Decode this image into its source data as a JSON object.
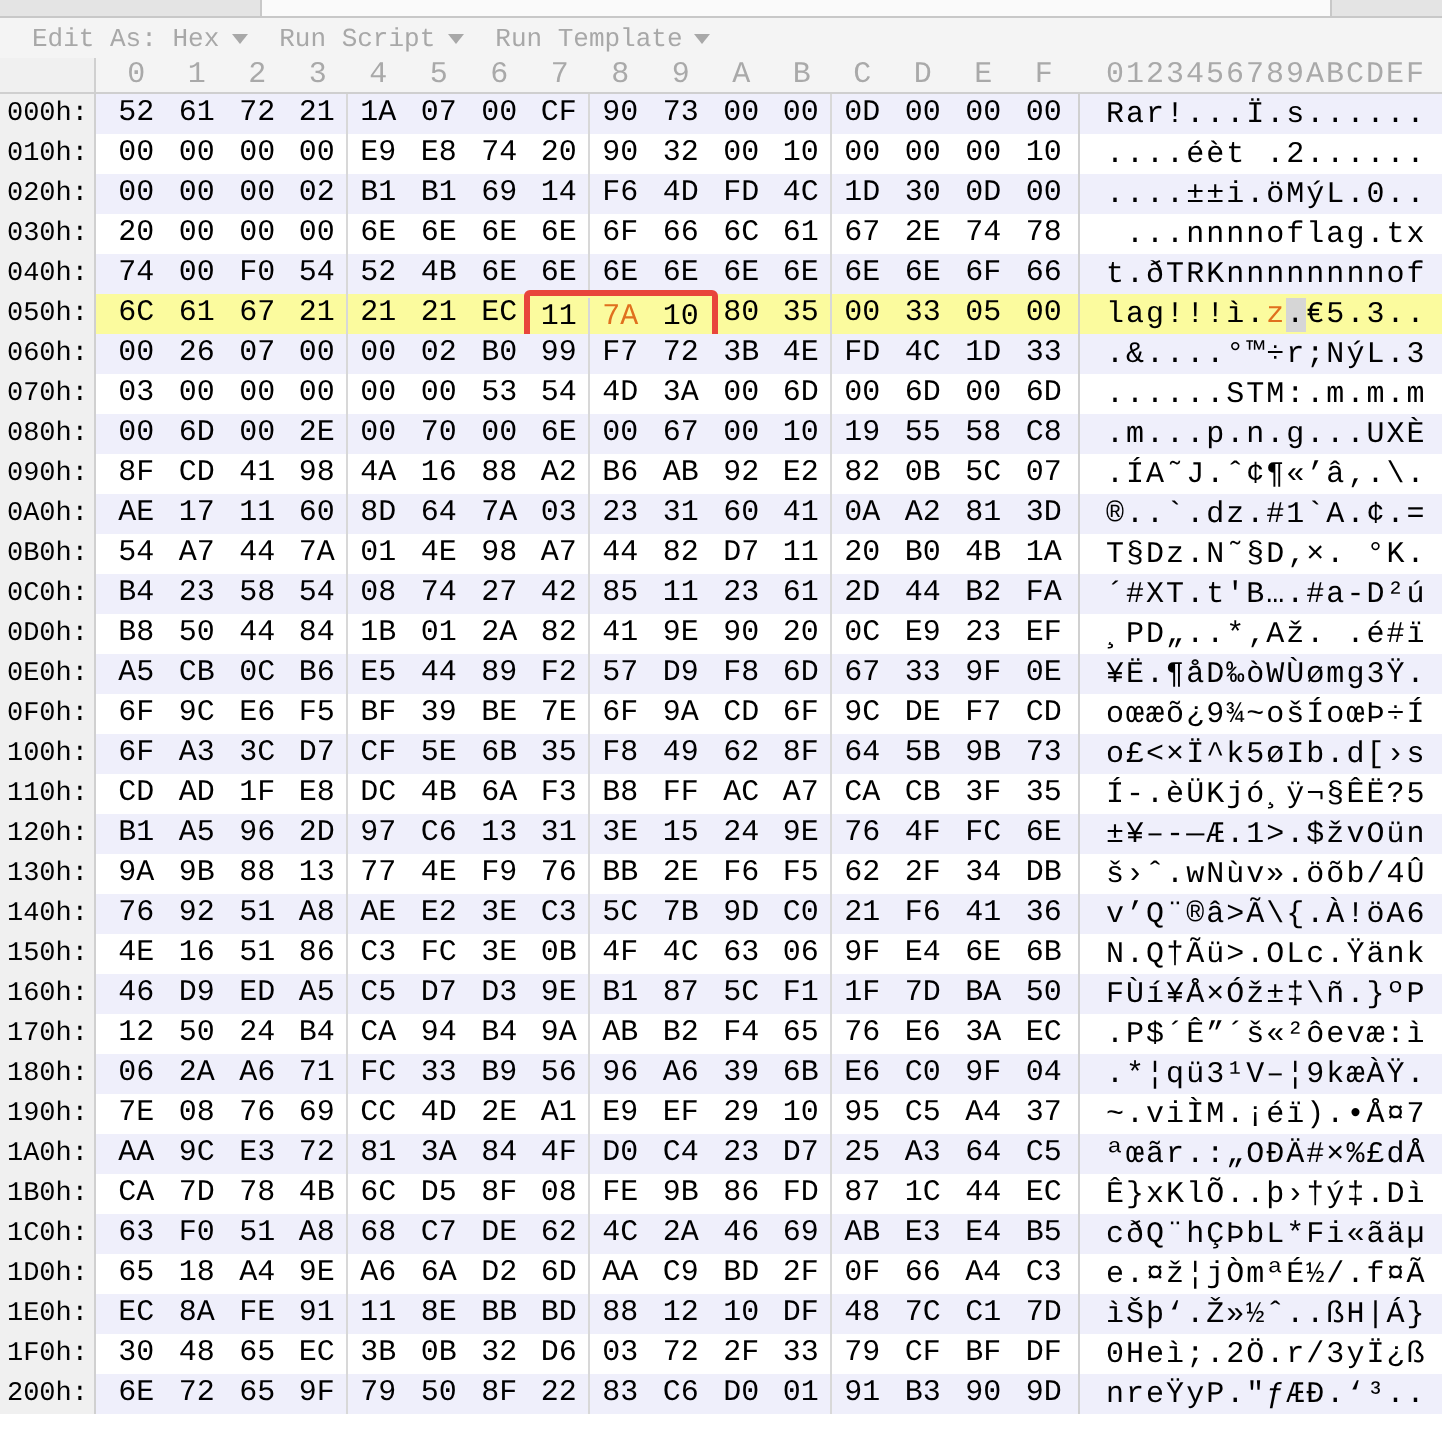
{
  "toolbar": [
    {
      "label": "Edit As: Hex",
      "disabled": true
    },
    {
      "label": "Run Script",
      "disabled": true
    },
    {
      "label": "Run Template",
      "disabled": true
    }
  ],
  "columns": [
    "0",
    "1",
    "2",
    "3",
    "4",
    "5",
    "6",
    "7",
    "8",
    "9",
    "A",
    "B",
    "C",
    "D",
    "E",
    "F"
  ],
  "ascii_header": "0123456789ABCDEF",
  "rows": [
    {
      "offset": "000h:",
      "current": false,
      "bytes": [
        "52",
        "61",
        "72",
        "21",
        "1A",
        "07",
        "00",
        "CF",
        "90",
        "73",
        "00",
        "00",
        "0D",
        "00",
        "00",
        "00"
      ],
      "ascii": "Rar!...Ï.s......"
    },
    {
      "offset": "010h:",
      "current": false,
      "bytes": [
        "00",
        "00",
        "00",
        "00",
        "E9",
        "E8",
        "74",
        "20",
        "90",
        "32",
        "00",
        "10",
        "00",
        "00",
        "00",
        "10"
      ],
      "ascii": "....éèt .2......"
    },
    {
      "offset": "020h:",
      "current": false,
      "bytes": [
        "00",
        "00",
        "00",
        "02",
        "B1",
        "B1",
        "69",
        "14",
        "F6",
        "4D",
        "FD",
        "4C",
        "1D",
        "30",
        "0D",
        "00"
      ],
      "ascii": "....±±i.öMýL.0.."
    },
    {
      "offset": "030h:",
      "current": false,
      "bytes": [
        "20",
        "00",
        "00",
        "00",
        "6E",
        "6E",
        "6E",
        "6E",
        "6F",
        "66",
        "6C",
        "61",
        "67",
        "2E",
        "74",
        "78"
      ],
      "ascii": " ...nnnnoflag.tx"
    },
    {
      "offset": "040h:",
      "current": false,
      "bytes": [
        "74",
        "00",
        "F0",
        "54",
        "52",
        "4B",
        "6E",
        "6E",
        "6E",
        "6E",
        "6E",
        "6E",
        "6E",
        "6E",
        "6F",
        "66"
      ],
      "ascii": "t.ðTRKnnnnnnnnof"
    },
    {
      "offset": "050h:",
      "current": true,
      "bytes": [
        "6C",
        "61",
        "67",
        "21",
        "21",
        "21",
        "EC",
        {
          "hex": "11",
          "boxed": true
        },
        {
          "hex": "7A",
          "boxed": true,
          "cursor": true
        },
        {
          "hex": "10",
          "boxed": true,
          "shadow": true
        },
        "80",
        "35",
        "00",
        "33",
        "05",
        "00"
      ],
      "ascii": "lag!!!ì.z.€5.3.."
    },
    {
      "offset": "060h:",
      "current": false,
      "bytes": [
        "00",
        "26",
        "07",
        "00",
        "00",
        "02",
        "B0",
        "99",
        "F7",
        "72",
        "3B",
        "4E",
        "FD",
        "4C",
        "1D",
        "33"
      ],
      "ascii": ".&....°™÷r;NýL.3"
    },
    {
      "offset": "070h:",
      "current": false,
      "bytes": [
        "03",
        "00",
        "00",
        "00",
        "00",
        "00",
        "53",
        "54",
        "4D",
        "3A",
        "00",
        "6D",
        "00",
        "6D",
        "00",
        "6D"
      ],
      "ascii": "......STM:.m.m.m"
    },
    {
      "offset": "080h:",
      "current": false,
      "bytes": [
        "00",
        "6D",
        "00",
        "2E",
        "00",
        "70",
        "00",
        "6E",
        "00",
        "67",
        "00",
        "10",
        "19",
        "55",
        "58",
        "C8"
      ],
      "ascii": ".m...p.n.g...UXÈ"
    },
    {
      "offset": "090h:",
      "current": false,
      "bytes": [
        "8F",
        "CD",
        "41",
        "98",
        "4A",
        "16",
        "88",
        "A2",
        "B6",
        "AB",
        "92",
        "E2",
        "82",
        "0B",
        "5C",
        "07"
      ],
      "ascii": ".ÍA˜J.ˆ¢¶«’â‚.\\."
    },
    {
      "offset": "0A0h:",
      "current": false,
      "bytes": [
        "AE",
        "17",
        "11",
        "60",
        "8D",
        "64",
        "7A",
        "03",
        "23",
        "31",
        "60",
        "41",
        "0A",
        "A2",
        "81",
        "3D"
      ],
      "ascii": "®..`.dz.#1`A.¢.="
    },
    {
      "offset": "0B0h:",
      "current": false,
      "bytes": [
        "54",
        "A7",
        "44",
        "7A",
        "01",
        "4E",
        "98",
        "A7",
        "44",
        "82",
        "D7",
        "11",
        "20",
        "B0",
        "4B",
        "1A"
      ],
      "ascii": "T§Dz.N˜§D‚×. °K."
    },
    {
      "offset": "0C0h:",
      "current": false,
      "bytes": [
        "B4",
        "23",
        "58",
        "54",
        "08",
        "74",
        "27",
        "42",
        "85",
        "11",
        "23",
        "61",
        "2D",
        "44",
        "B2",
        "FA"
      ],
      "ascii": "´#XT.t'B….#a-D²ú"
    },
    {
      "offset": "0D0h:",
      "current": false,
      "bytes": [
        "B8",
        "50",
        "44",
        "84",
        "1B",
        "01",
        "2A",
        "82",
        "41",
        "9E",
        "90",
        "20",
        "0C",
        "E9",
        "23",
        "EF"
      ],
      "ascii": "¸PD„..*‚Až. .é#ï"
    },
    {
      "offset": "0E0h:",
      "current": false,
      "bytes": [
        "A5",
        "CB",
        "0C",
        "B6",
        "E5",
        "44",
        "89",
        "F2",
        "57",
        "D9",
        "F8",
        "6D",
        "67",
        "33",
        "9F",
        "0E"
      ],
      "ascii": "¥Ë.¶åD‰òWÙømg3Ÿ."
    },
    {
      "offset": "0F0h:",
      "current": false,
      "bytes": [
        "6F",
        "9C",
        "E6",
        "F5",
        "BF",
        "39",
        "BE",
        "7E",
        "6F",
        "9A",
        "CD",
        "6F",
        "9C",
        "DE",
        "F7",
        "CD"
      ],
      "ascii": "oœæõ¿9¾~ošÍoœÞ÷Í"
    },
    {
      "offset": "100h:",
      "current": false,
      "bytes": [
        "6F",
        "A3",
        "3C",
        "D7",
        "CF",
        "5E",
        "6B",
        "35",
        "F8",
        "49",
        "62",
        "8F",
        "64",
        "5B",
        "9B",
        "73"
      ],
      "ascii": "o£<×Ï^k5øIb.d[›s"
    },
    {
      "offset": "110h:",
      "current": false,
      "bytes": [
        "CD",
        "AD",
        "1F",
        "E8",
        "DC",
        "4B",
        "6A",
        "F3",
        "B8",
        "FF",
        "AC",
        "A7",
        "CA",
        "CB",
        "3F",
        "35"
      ],
      "ascii": "Í-.èÜKjó¸ÿ¬§ÊË?5"
    },
    {
      "offset": "120h:",
      "current": false,
      "bytes": [
        "B1",
        "A5",
        "96",
        "2D",
        "97",
        "C6",
        "13",
        "31",
        "3E",
        "15",
        "24",
        "9E",
        "76",
        "4F",
        "FC",
        "6E"
      ],
      "ascii": "±¥–-—Æ.1>.$žvOün"
    },
    {
      "offset": "130h:",
      "current": false,
      "bytes": [
        "9A",
        "9B",
        "88",
        "13",
        "77",
        "4E",
        "F9",
        "76",
        "BB",
        "2E",
        "F6",
        "F5",
        "62",
        "2F",
        "34",
        "DB"
      ],
      "ascii": "š›ˆ.wNùv».öõb/4Û"
    },
    {
      "offset": "140h:",
      "current": false,
      "bytes": [
        "76",
        "92",
        "51",
        "A8",
        "AE",
        "E2",
        "3E",
        "C3",
        "5C",
        "7B",
        "9D",
        "C0",
        "21",
        "F6",
        "41",
        "36"
      ],
      "ascii": "v’Q¨®â>Ã\\{.À!öA6"
    },
    {
      "offset": "150h:",
      "current": false,
      "bytes": [
        "4E",
        "16",
        "51",
        "86",
        "C3",
        "FC",
        "3E",
        "0B",
        "4F",
        "4C",
        "63",
        "06",
        "9F",
        "E4",
        "6E",
        "6B"
      ],
      "ascii": "N.Q†Ãü>.OLc.Ÿänk"
    },
    {
      "offset": "160h:",
      "current": false,
      "bytes": [
        "46",
        "D9",
        "ED",
        "A5",
        "C5",
        "D7",
        "D3",
        "9E",
        "B1",
        "87",
        "5C",
        "F1",
        "1F",
        "7D",
        "BA",
        "50"
      ],
      "ascii": "FÙí¥Å×Óž±‡\\ñ.}ºP"
    },
    {
      "offset": "170h:",
      "current": false,
      "bytes": [
        "12",
        "50",
        "24",
        "B4",
        "CA",
        "94",
        "B4",
        "9A",
        "AB",
        "B2",
        "F4",
        "65",
        "76",
        "E6",
        "3A",
        "EC"
      ],
      "ascii": ".P$´Ê”´š«²ôevæ:ì"
    },
    {
      "offset": "180h:",
      "current": false,
      "bytes": [
        "06",
        "2A",
        "A6",
        "71",
        "FC",
        "33",
        "B9",
        "56",
        "96",
        "A6",
        "39",
        "6B",
        "E6",
        "C0",
        "9F",
        "04"
      ],
      "ascii": ".*¦qü3¹V–¦9kæÀŸ."
    },
    {
      "offset": "190h:",
      "current": false,
      "bytes": [
        "7E",
        "08",
        "76",
        "69",
        "CC",
        "4D",
        "2E",
        "A1",
        "E9",
        "EF",
        "29",
        "10",
        "95",
        "C5",
        "A4",
        "37"
      ],
      "ascii": "~.viÌM.¡éï).•Å¤7"
    },
    {
      "offset": "1A0h:",
      "current": false,
      "bytes": [
        "AA",
        "9C",
        "E3",
        "72",
        "81",
        "3A",
        "84",
        "4F",
        "D0",
        "C4",
        "23",
        "D7",
        "25",
        "A3",
        "64",
        "C5"
      ],
      "ascii": "ªœãr.:„OÐÄ#×%£dÅ"
    },
    {
      "offset": "1B0h:",
      "current": false,
      "bytes": [
        "CA",
        "7D",
        "78",
        "4B",
        "6C",
        "D5",
        "8F",
        "08",
        "FE",
        "9B",
        "86",
        "FD",
        "87",
        "1C",
        "44",
        "EC"
      ],
      "ascii": "Ê}xKlÕ..þ›†ý‡.Dì"
    },
    {
      "offset": "1C0h:",
      "current": false,
      "bytes": [
        "63",
        "F0",
        "51",
        "A8",
        "68",
        "C7",
        "DE",
        "62",
        "4C",
        "2A",
        "46",
        "69",
        "AB",
        "E3",
        "E4",
        "B5"
      ],
      "ascii": "cðQ¨hÇÞbL*Fi«ãäµ"
    },
    {
      "offset": "1D0h:",
      "current": false,
      "bytes": [
        "65",
        "18",
        "A4",
        "9E",
        "A6",
        "6A",
        "D2",
        "6D",
        "AA",
        "C9",
        "BD",
        "2F",
        "0F",
        "66",
        "A4",
        "C3"
      ],
      "ascii": "e.¤ž¦jÒmªÉ½/.f¤Ã"
    },
    {
      "offset": "1E0h:",
      "current": false,
      "bytes": [
        "EC",
        "8A",
        "FE",
        "91",
        "11",
        "8E",
        "BB",
        "BD",
        "88",
        "12",
        "10",
        "DF",
        "48",
        "7C",
        "C1",
        "7D"
      ],
      "ascii": "ìŠþ‘.Ž»½ˆ..ßH|Á}"
    },
    {
      "offset": "1F0h:",
      "current": false,
      "bytes": [
        "30",
        "48",
        "65",
        "EC",
        "3B",
        "0B",
        "32",
        "D6",
        "03",
        "72",
        "2F",
        "33",
        "79",
        "CF",
        "BF",
        "DF"
      ],
      "ascii": "0Heì;.2Ö.r/3yÏ¿ß"
    },
    {
      "offset": "200h:",
      "current": false,
      "bytes": [
        "6E",
        "72",
        "65",
        "9F",
        "79",
        "50",
        "8F",
        "22",
        "83",
        "C6",
        "D0",
        "01",
        "91",
        "B3",
        "90",
        "9D"
      ],
      "ascii": "nreŸyP.\"ƒÆÐ.‘³.."
    }
  ]
}
